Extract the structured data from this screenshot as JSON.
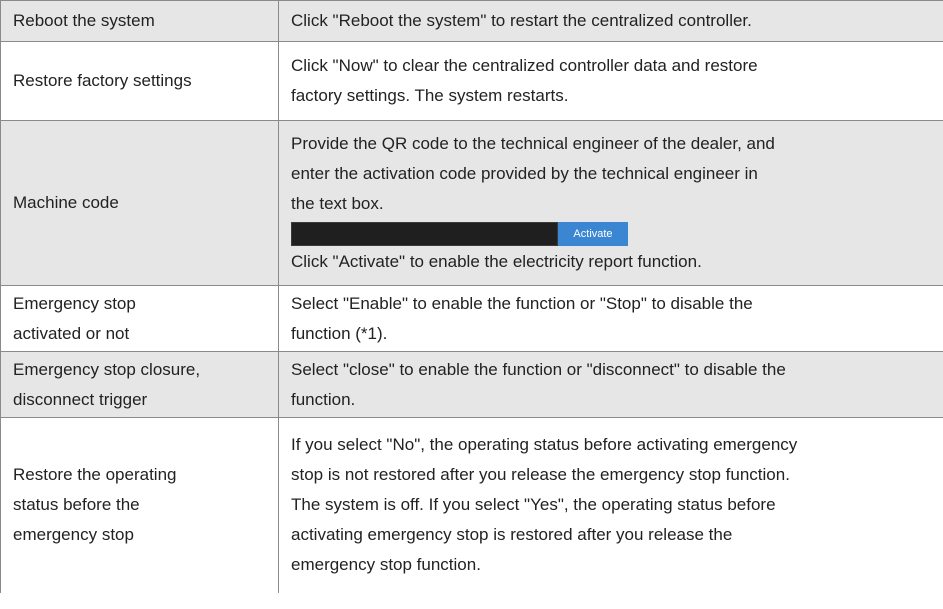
{
  "rows": [
    {
      "name_lines": [
        "Reboot the system"
      ],
      "desc_lines": [
        "Click \"Reboot the system\" to restart the centralized controller."
      ]
    },
    {
      "name_lines": [
        "Restore factory settings"
      ],
      "desc_lines": [
        "Click \"Now\" to clear the centralized controller data and restore",
        "factory settings. The system restarts."
      ]
    },
    {
      "name_lines": [
        "Machine code"
      ],
      "desc_lines": [
        "Provide the QR code to the technical engineer of the dealer, and",
        "enter the activation code provided by the technical engineer in",
        "the text box."
      ],
      "activation": {
        "input_value": "",
        "button_label": "Activate"
      },
      "desc_after": "Click \"Activate\" to enable the electricity report function."
    },
    {
      "name_lines": [
        "Emergency stop",
        "activated or not"
      ],
      "desc_lines": [
        "Select \"Enable\" to enable the function or \"Stop\" to disable the",
        "function (*1)."
      ]
    },
    {
      "name_lines": [
        "Emergency stop closure,",
        "disconnect trigger"
      ],
      "desc_lines": [
        "Select \"close\" to enable the function or \"disconnect\" to disable the",
        "function."
      ]
    },
    {
      "name_lines": [
        "Restore the operating",
        "status before the",
        "emergency stop"
      ],
      "desc_lines": [
        "If you select \"No\", the operating status before activating emergency",
        "stop is not restored after you release the emergency stop function.",
        "The system is off. If you select \"Yes\", the operating status before",
        "activating emergency stop is restored after you release the",
        "emergency stop function."
      ]
    }
  ],
  "colors": {
    "shaded_row": "#e6e6e6",
    "border": "#8a8a8a",
    "button": "#3b86d3",
    "input": "#1f1f1f"
  }
}
